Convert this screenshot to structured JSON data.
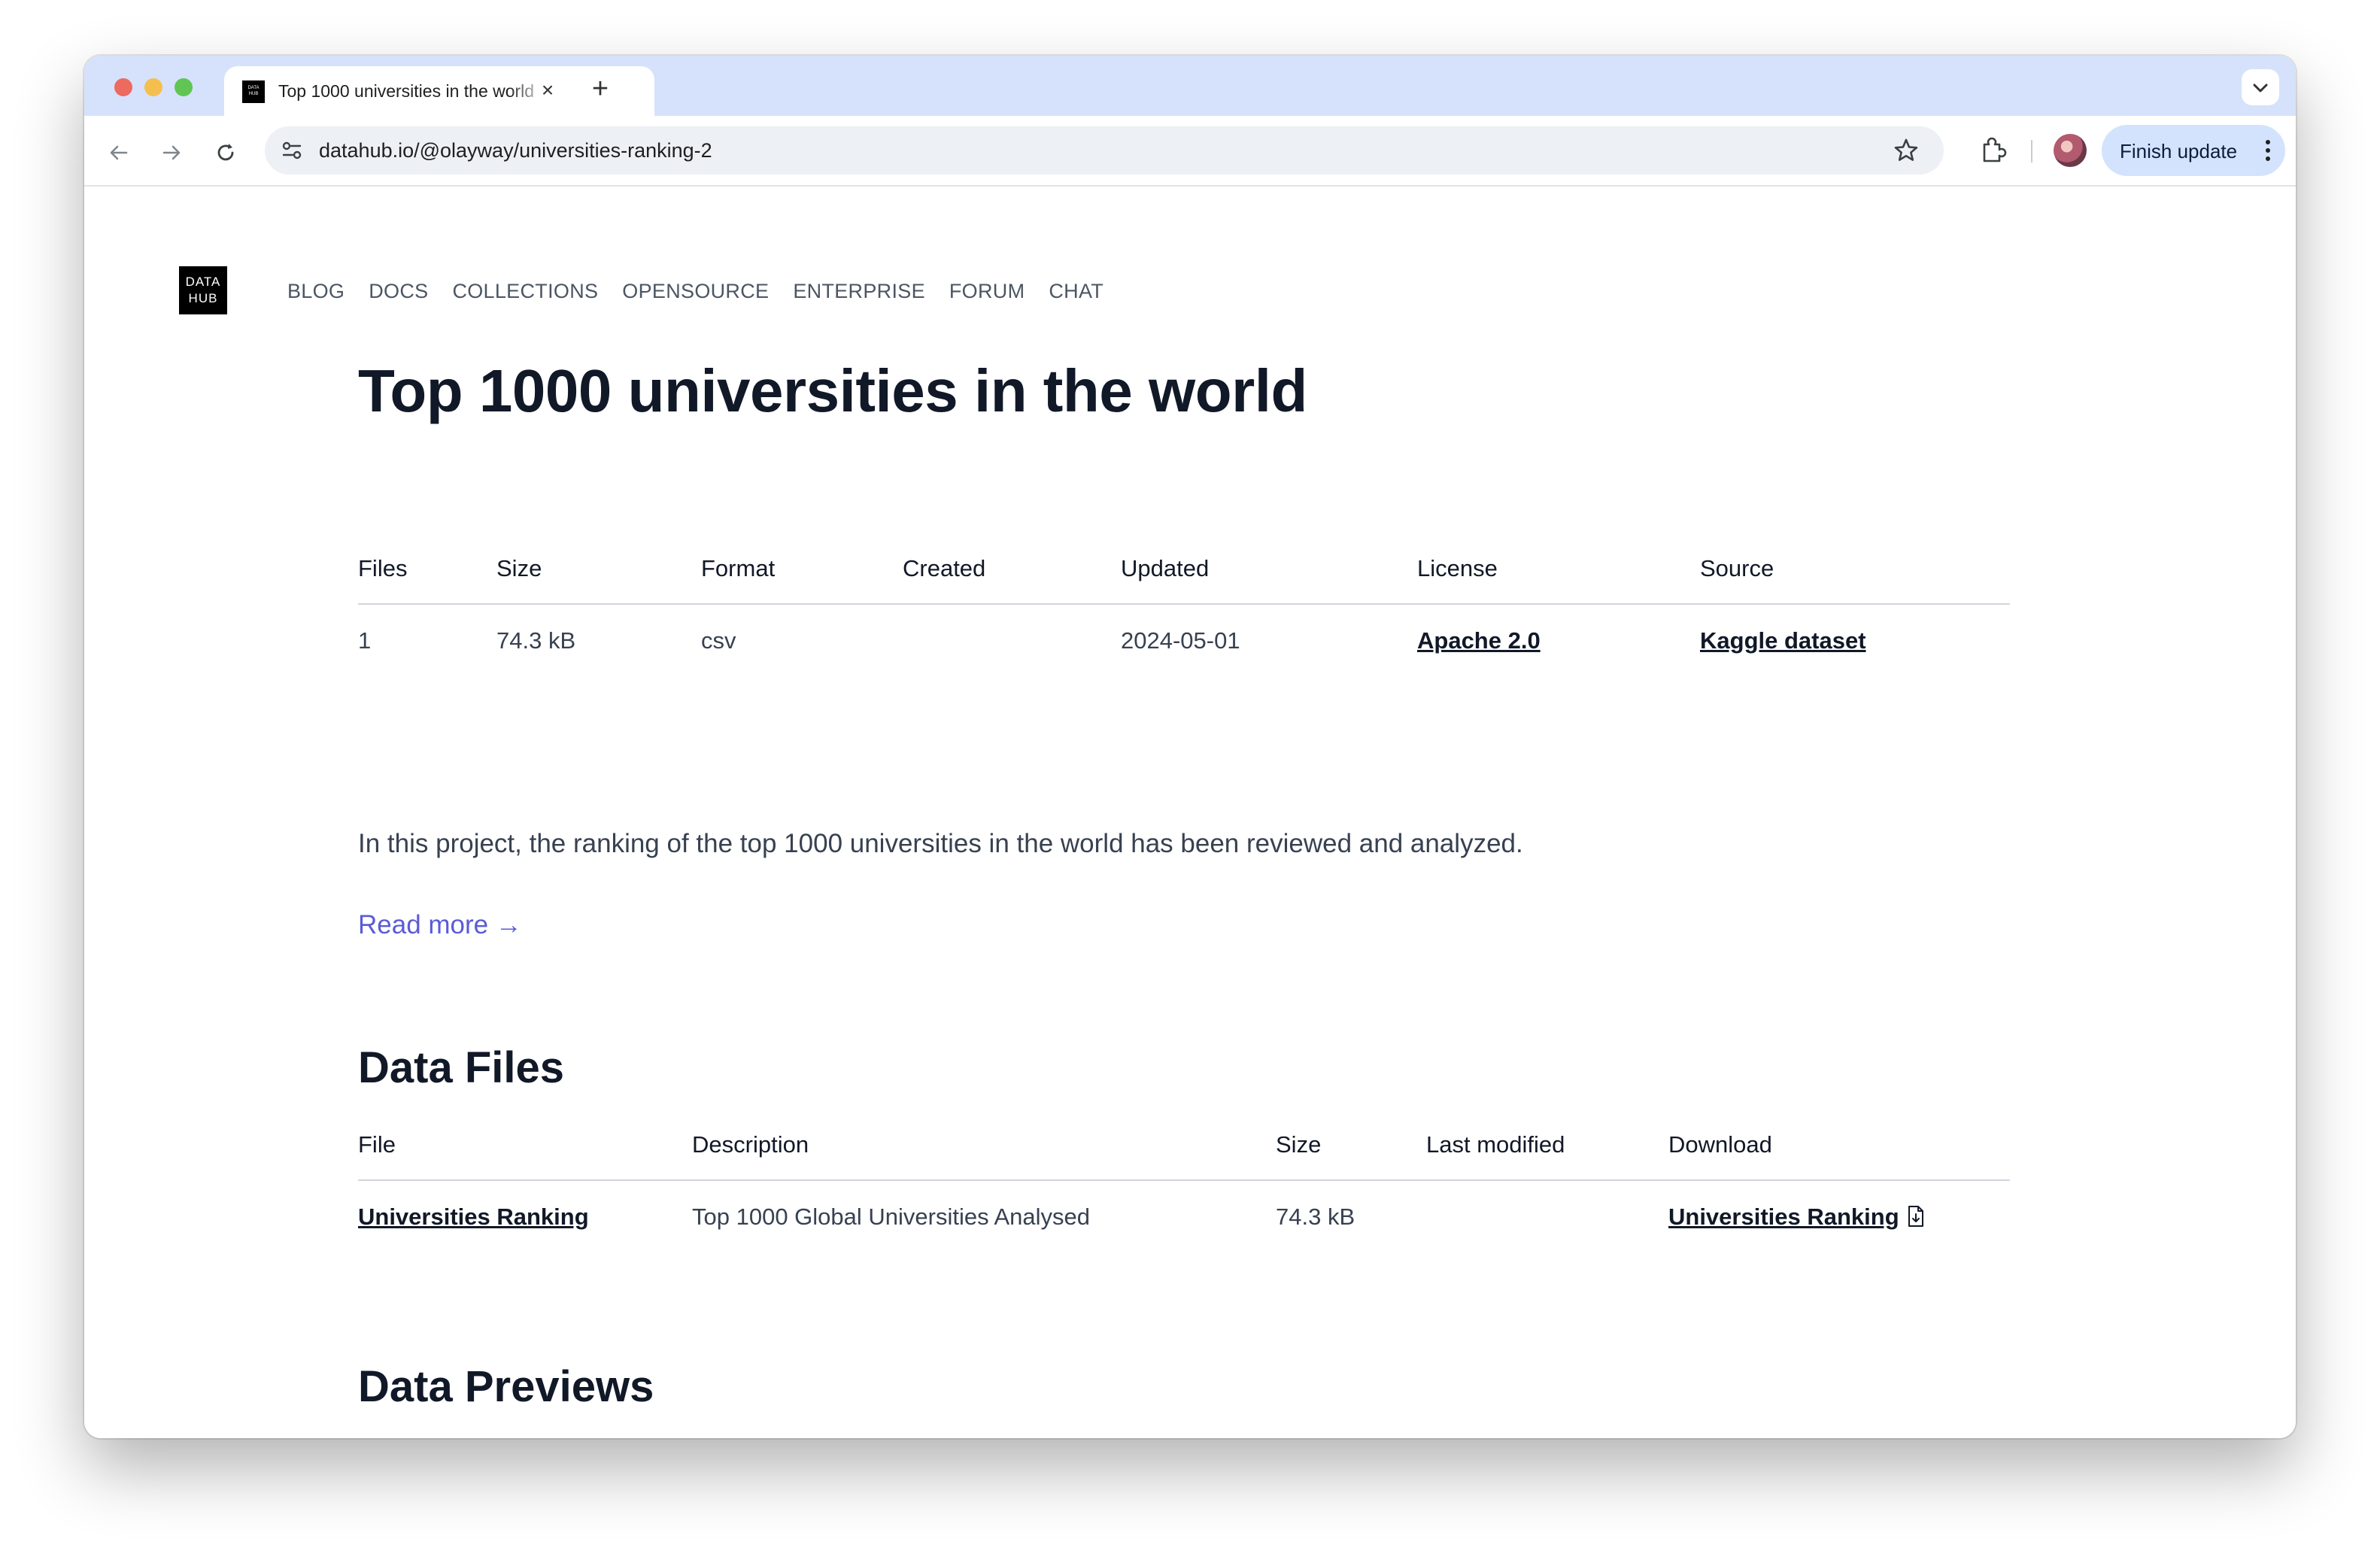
{
  "browser": {
    "tab_title": "Top 1000 universities in the world",
    "url": "datahub.io/@olayway/universities-ranking-2",
    "update_button": "Finish update"
  },
  "site": {
    "logo_line1": "DATA",
    "logo_line2": "HUB",
    "nav": [
      "BLOG",
      "DOCS",
      "COLLECTIONS",
      "OPENSOURCE",
      "ENTERPRISE",
      "FORUM",
      "CHAT"
    ]
  },
  "dataset": {
    "title": "Top 1000 universities in the world",
    "meta_headers": [
      "Files",
      "Size",
      "Format",
      "Created",
      "Updated",
      "License",
      "Source"
    ],
    "meta_values": {
      "files": "1",
      "size": "74.3 kB",
      "format": "csv",
      "created": "",
      "updated": "2024-05-01",
      "license": "Apache 2.0",
      "source": "Kaggle dataset"
    },
    "description": "In this project, the ranking of the top 1000 universities in the world has been reviewed and analyzed.",
    "read_more": "Read more →"
  },
  "data_files": {
    "heading": "Data Files",
    "headers": [
      "File",
      "Description",
      "Size",
      "Last modified",
      "Download"
    ],
    "rows": [
      {
        "file": "Universities Ranking",
        "description": "Top 1000 Global Universities Analysed",
        "size": "74.3 kB",
        "last_modified": "",
        "download": "Universities Ranking"
      }
    ]
  },
  "data_previews": {
    "heading": "Data Previews"
  },
  "colors": {
    "link_accent": "#5b5bd6",
    "tabstrip": "#d6e2fb",
    "update_pill": "#d3e3fd"
  }
}
